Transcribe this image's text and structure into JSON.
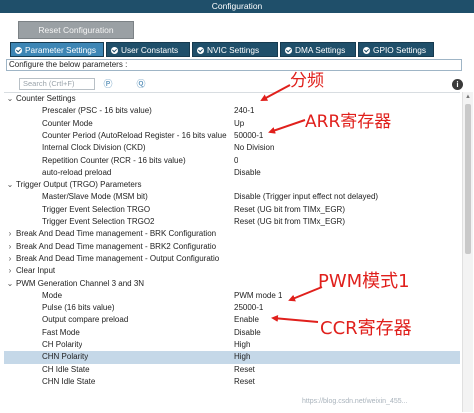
{
  "window": {
    "title": "Configuration"
  },
  "toolbar": {
    "reset_label": "Reset Configuration"
  },
  "tabs": [
    {
      "label": "Parameter Settings",
      "active": true
    },
    {
      "label": "User Constants",
      "active": false
    },
    {
      "label": "NVIC Settings",
      "active": false
    },
    {
      "label": "DMA Settings",
      "active": false
    },
    {
      "label": "GPIO Settings",
      "active": false
    }
  ],
  "hint": "Configure the below parameters :",
  "search": {
    "placeholder": "Search (Crtl+F)"
  },
  "tree": {
    "counter_settings": {
      "label": "Counter Settings",
      "rows": [
        {
          "name": "Prescaler (PSC - 16 bits value)",
          "value": "240-1"
        },
        {
          "name": "Counter Mode",
          "value": "Up"
        },
        {
          "name": "Counter Period (AutoReload Register - 16 bits value",
          "value": "50000-1"
        },
        {
          "name": "Internal Clock Division (CKD)",
          "value": "No Division"
        },
        {
          "name": "Repetition Counter (RCR - 16 bits value)",
          "value": "0"
        },
        {
          "name": "auto-reload preload",
          "value": "Disable"
        }
      ]
    },
    "trigger_output": {
      "label": "Trigger Output (TRGO) Parameters",
      "rows": [
        {
          "name": "Master/Slave Mode (MSM bit)",
          "value": "Disable (Trigger input effect not delayed)"
        },
        {
          "name": "Trigger Event Selection TRGO",
          "value": "Reset (UG bit from TIMx_EGR)"
        },
        {
          "name": "Trigger Event Selection TRGO2",
          "value": "Reset (UG bit from TIMx_EGR)"
        }
      ]
    },
    "collapsed": [
      "Break And Dead Time management - BRK Configuration",
      "Break And Dead Time management - BRK2 Configuratio",
      "Break And Dead Time management - Output Configuratio",
      "Clear Input"
    ],
    "pwm_channel": {
      "label": "PWM Generation Channel 3 and 3N",
      "rows": [
        {
          "name": "Mode",
          "value": "PWM mode 1"
        },
        {
          "name": "Pulse (16 bits value)",
          "value": "25000-1"
        },
        {
          "name": "Output compare preload",
          "value": "Enable"
        },
        {
          "name": "Fast Mode",
          "value": "Disable"
        },
        {
          "name": "CH Polarity",
          "value": "High"
        },
        {
          "name": "CHN Polarity",
          "value": "High",
          "selected": true
        },
        {
          "name": "CH Idle State",
          "value": "Reset"
        },
        {
          "name": "CHN Idle State",
          "value": "Reset"
        }
      ]
    }
  },
  "annotations": {
    "color": "#e0201c",
    "prescaler_label": "分频",
    "arr_label": "ARR寄存器",
    "pwm_label": "PWM模式1",
    "ccr_label": "CCR寄存器"
  },
  "watermark": "https://blog.csdn.net/weixin_455..."
}
